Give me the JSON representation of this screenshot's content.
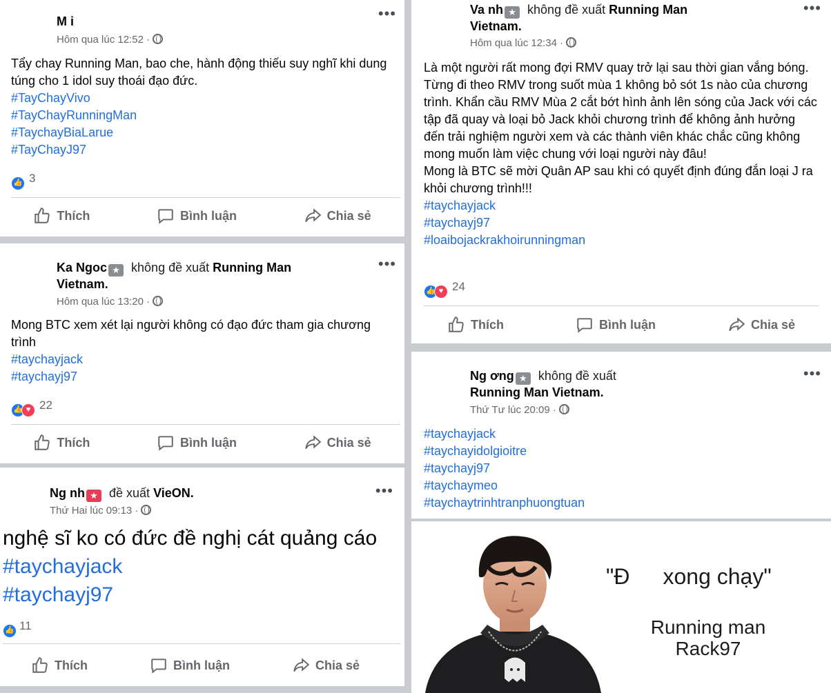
{
  "actions": {
    "like": "Thích",
    "comment": "Bình luận",
    "share": "Chia sẻ"
  },
  "more": "•••",
  "posts": [
    {
      "author": "M   i",
      "time": "Hôm qua lúc 12:52 ·",
      "text": "Tẩy chay Running Man, bao che, hành động thiếu suy nghĩ khi dung túng cho 1 idol suy thoái đạo đức.",
      "tags": [
        "#TayChayVivo",
        "#TayChayRunningMan",
        "#TaychayBiaLarue",
        "#TayChayJ97"
      ],
      "reactions": "3"
    },
    {
      "author": "Ka      Ngoc",
      "recommends": "không đề xuất",
      "page": "Running Man",
      "page2": "Vietnam.",
      "time": "Hôm qua lúc 13:20 ·",
      "text": "Mong BTC xem xét lại người không có đạo đức tham gia chương trình",
      "tags": [
        "#taychayjack",
        "#taychayj97"
      ],
      "reactions": "22"
    },
    {
      "author": "Ng      nh",
      "recommends": "đề xuất",
      "page": "VieON.",
      "time": "Thứ Hai lúc 09:13 ·",
      "text": "nghệ sĩ ko có đức đề nghị cát quảng cáo",
      "tags": [
        "#taychayjack",
        "#taychayj97"
      ],
      "reactions": "11"
    },
    {
      "author": "Va         nh",
      "recommends": "không đề xuất",
      "page": "Running Man",
      "page2": "Vietnam.",
      "time": "Hôm qua lúc 12:34 ·",
      "text1": "Là một người rất mong đợi RMV quay trở lại sau thời gian vắng bóng. Từng đi theo RMV trong suốt mùa 1 không bỏ sót 1s nào của chương trình. Khẩn cầu RMV Mùa 2 cắt bớt hình ảnh lên sóng của Jack với các tập đã quay và loại bỏ Jack khỏi chương trình để không ảnh hưởng đến trải nghiệm người xem và các thành viên khác chắc cũng không mong muốn làm việc chung với loại người này đâu!",
      "text2": "Mong là BTC sẽ mời Quân AP sau khi có quyết định đúng đắn loại J ra khỏi chương trình!!!",
      "tags": [
        "#taychayjack",
        "#taychayj97",
        "#loaibojackrakhoirunningman"
      ],
      "reactions": "24"
    },
    {
      "author": "Ng          ơng",
      "recommends": "không đề xuất",
      "page": "Running Man Vietnam.",
      "time": "Thứ Tư lúc 20:09 ·",
      "tags": [
        "#taychayjack",
        "#taychayidolgioitre",
        "#taychayj97",
        "#taychaymeo",
        "#taychaytrinhtranphuongtuan"
      ]
    }
  ],
  "meme": {
    "quote_open": "\"Đ",
    "quote_close": "xong chạy\"",
    "line1": "Running man",
    "line2": "Rack97"
  },
  "colors": {
    "link": "#216fdb",
    "like": "#1877f2",
    "love": "#f33e58",
    "separator": "#c9ccd1"
  }
}
